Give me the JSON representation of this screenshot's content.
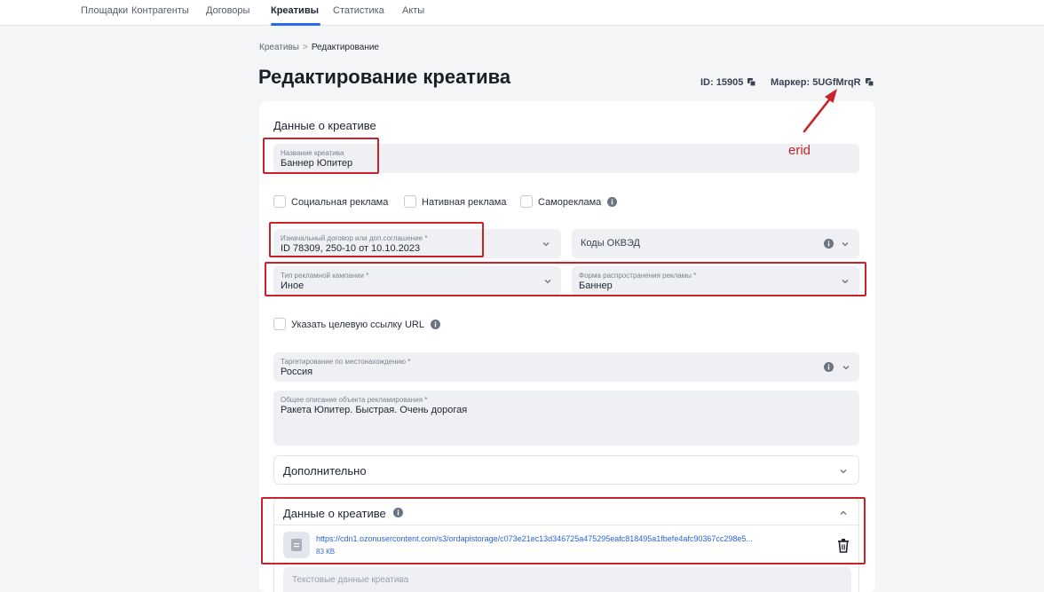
{
  "nav": {
    "items": [
      "Площадки",
      "Контрагенты",
      "Договоры",
      "Креативы",
      "Статистика",
      "Акты"
    ],
    "active_index": 3
  },
  "breadcrumb": {
    "parent": "Креативы",
    "separator": ">",
    "current": "Редактирование"
  },
  "page": {
    "title": "Редактирование креатива",
    "id_label": "ID: 15905",
    "marker_label": "Маркер: 5UGfMrqR"
  },
  "form": {
    "section_title": "Данные о креативе",
    "name": {
      "label": "Название креатива",
      "value": "Баннер Юпитер"
    },
    "checkboxes": [
      "Социальная реклама",
      "Нативная реклама",
      "Самореклама"
    ],
    "contract": {
      "label": "Изначальный договор или доп.соглашение *",
      "value": "ID 78309, 250-10 от 10.10.2023"
    },
    "okved": {
      "placeholder": "Коды ОКВЭД"
    },
    "campaign_type": {
      "label": "Тип рекламной кампании *",
      "value": "Иное"
    },
    "ad_form": {
      "label": "Форма распространения рекламы *",
      "value": "Баннер"
    },
    "target_url_checkbox": "Указать целевую ссылку URL",
    "geo": {
      "label": "Таргетирование по местонахождению *",
      "value": "Россия"
    },
    "description": {
      "label": "Общее описание объекта рекламирования *",
      "value": "Ракета Юпитер. Быстрая. Очень дорогая"
    },
    "additional": {
      "title": "Дополнительно"
    },
    "creative_data": {
      "title": "Данные о креативе",
      "file_url": "https://cdn1.ozonusercontent.com/s3/ordapistorage/c073e21ec13d346725a475295eafc818495a1fbefe4afc90367cc298e5...",
      "file_size": "83 КВ",
      "text_placeholder": "Текстовые данные креатива"
    }
  },
  "annotation": {
    "label": "erid",
    "color": "#c8232c"
  },
  "colors": {
    "accent": "#2a6af0",
    "field_bg": "#eef0f3",
    "highlight": "#c8232c"
  }
}
